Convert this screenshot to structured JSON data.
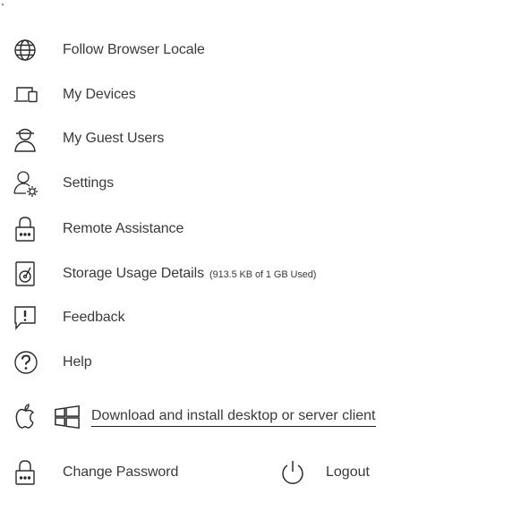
{
  "menu": {
    "items": [
      {
        "label": "Follow Browser Locale",
        "icon": "globe-icon"
      },
      {
        "label": "My Devices",
        "icon": "devices-icon"
      },
      {
        "label": "My Guest Users",
        "icon": "guest-user-icon"
      },
      {
        "label": "Settings",
        "icon": "user-settings-icon"
      },
      {
        "label": "Remote Assistance",
        "icon": "lock-icon"
      },
      {
        "label": "Storage Usage Details",
        "icon": "storage-disk-icon",
        "detail": "(913.5 KB of 1 GB Used)"
      },
      {
        "label": "Feedback",
        "icon": "feedback-icon"
      },
      {
        "label": "Help",
        "icon": "help-icon"
      }
    ],
    "download": {
      "label": "Download and install desktop or server client",
      "icons": [
        "apple-icon",
        "windows-icon"
      ]
    },
    "change_password": {
      "label": "Change Password",
      "icon": "lock-icon"
    },
    "logout": {
      "label": "Logout",
      "icon": "power-icon"
    }
  },
  "colors": {
    "text": "#3a3a3a",
    "icon_stroke": "#2b2b2b",
    "background": "#ffffff"
  }
}
